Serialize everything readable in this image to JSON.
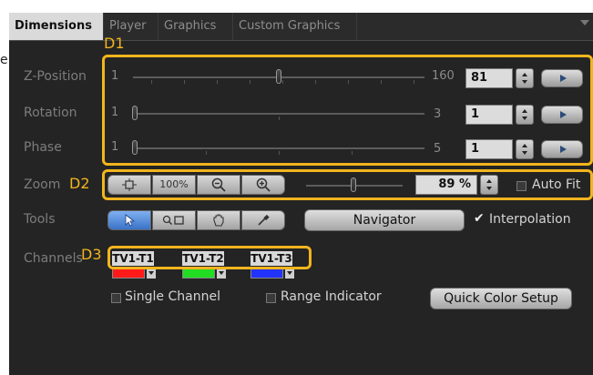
{
  "tabs": [
    {
      "label": "Dimensions",
      "active": true
    },
    {
      "label": "Player",
      "active": false
    },
    {
      "label": "Graphics",
      "active": false
    },
    {
      "label": "Custom Graphics",
      "active": false
    }
  ],
  "edge_text": "e",
  "annotations": {
    "d1": "D1",
    "d2": "D2",
    "d3": "D3"
  },
  "rows": {
    "z_position": {
      "label": "Z-Position",
      "min": "1",
      "max": "160",
      "value": "81"
    },
    "rotation": {
      "label": "Rotation",
      "min": "1",
      "max": "3",
      "value": "1"
    },
    "phase": {
      "label": "Phase",
      "min": "1",
      "max": "5",
      "value": "1"
    }
  },
  "zoom": {
    "label": "Zoom",
    "fit_icon": "fit-to-window-icon",
    "preset_label": "100%",
    "value": "89 %",
    "auto_fit_label": "Auto Fit",
    "auto_fit_checked": false
  },
  "tools": {
    "label": "Tools",
    "tool_icons": [
      "arrow-pointer-icon",
      "zoom-rect-icon",
      "hand-pan-icon",
      "eyedropper-icon"
    ],
    "navigator_label": "Navigator",
    "interpolation_label": "Interpolation",
    "interpolation_checked": true
  },
  "channels": {
    "label": "Channels",
    "items": [
      {
        "name": "TV1-T1",
        "color": "#ff1a1a"
      },
      {
        "name": "TV1-T2",
        "color": "#22dd22"
      },
      {
        "name": "TV1-T3",
        "color": "#2233ff"
      }
    ],
    "single_channel_label": "Single Channel",
    "range_indicator_label": "Range Indicator",
    "quick_color_setup_label": "Quick Color Setup"
  },
  "colors": {
    "highlight": "#f2b51d",
    "panel_bg": "#242424",
    "active_tab_bg": "#dadada",
    "selected_tool": "#3a72c8"
  }
}
